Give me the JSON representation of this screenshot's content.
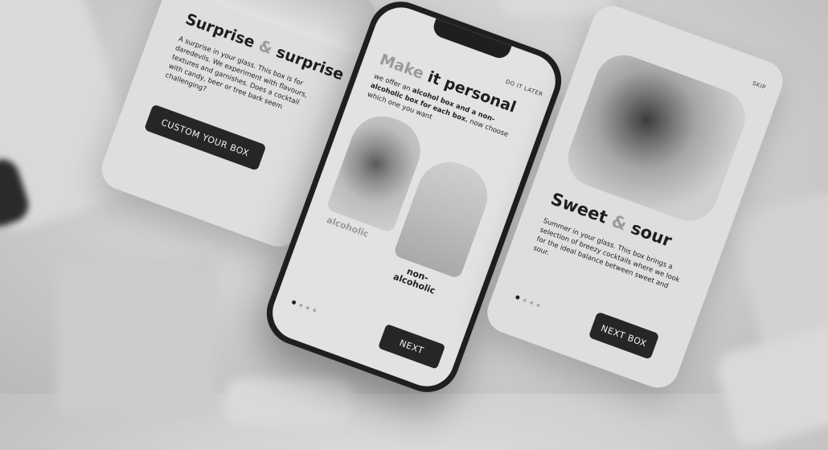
{
  "left_card": {
    "title_part1": "Surprise ",
    "title_amp": "&",
    "title_part2": " surprise",
    "body": "A surprise in your glass. This box is for daredevils. We experiment with flavours, textures and garnishes. Does a cocktail with candy, beer or tree bark seem challenging?",
    "button": "CUSTOM YOUR BOX"
  },
  "phone": {
    "skip": "DO IT LATER",
    "title_part1": "Make ",
    "title_part2": "it personal",
    "subtitle_intro": "we offer an ",
    "subtitle_bold": "alcohol box and a non-alcoholic box for each box.",
    "subtitle_end": " now choose which one you want",
    "option1": "alcoholic",
    "option2_line1": "non-",
    "option2_line2": "alcoholic",
    "button": "NEXT"
  },
  "right_card": {
    "skip": "SKIP",
    "title_part1": "Sweet ",
    "title_amp": "&",
    "title_part2": " sour",
    "body": "Summer in your glass. This box brings a selection of breezy cocktails where we look for the ideal balance between sweet and sour.",
    "button": "NEXT BOX"
  },
  "colors": {
    "background": "#cfcfcf",
    "card": "#dedede",
    "button": "#262626",
    "accent": "#9a9a9a"
  },
  "icons": [
    "cocktail-glass-photo",
    "bottle-photo",
    "pagination-dots"
  ]
}
